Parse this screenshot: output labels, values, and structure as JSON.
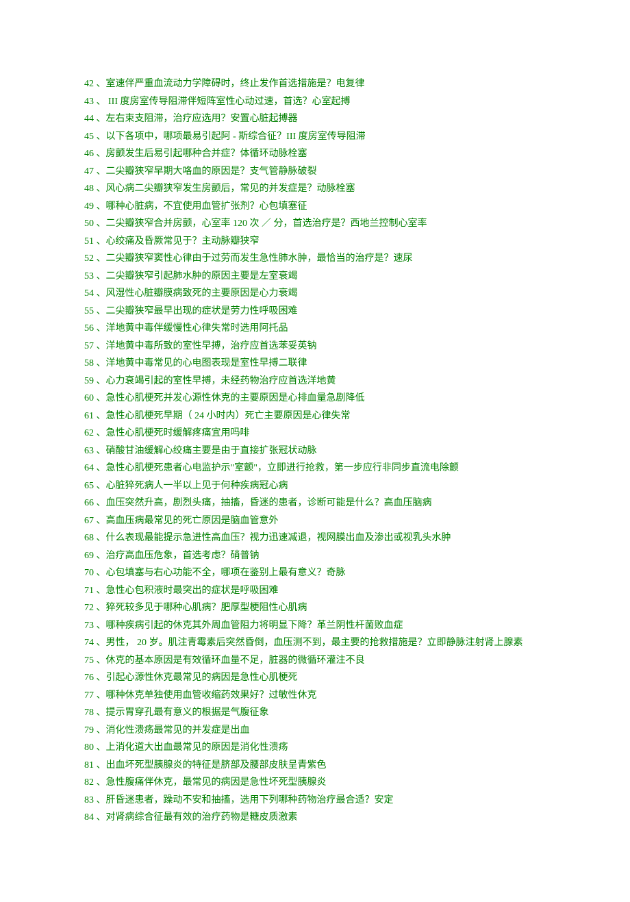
{
  "items": [
    "42 、室速伴严重血流动力学障碍时，终止发作首选措施是？电复律",
    "43 、 III 度房室传导阻滞伴短阵室性心动过速，首选？心室起搏",
    "44 、左右束支阻滞，治疗应选用？安置心脏起搏器",
    "45 、以下各项中，哪项最易引起阿 - 斯综合征？III 度房室传导阻滞",
    "46 、房颤发生后易引起哪种合并症？体循环动脉栓塞",
    "47 、二尖瓣狭窄早期大咯血的原因是？支气管静脉破裂",
    "48 、风心病二尖瓣狭窄发生房颤后，常见的并发症是？动脉栓塞",
    "49 、哪种心脏病，不宜使用血管扩张剂？心包填塞征",
    "50 、二尖瓣狭窄合并房颤，心室率 120 次 ／ 分，首选治疗是？西地兰控制心室率",
    "51 、心绞痛及昏厥常见于？主动脉瓣狭窄",
    "52 、二尖瓣狭窄窦性心律由于过劳而发生急性肺水肿，最恰当的治疗是？速尿",
    "53 、二尖瓣狭窄引起肺水肿的原因主要是左室衰竭",
    "54 、风湿性心脏瓣膜病致死的主要原因是心力衰竭",
    "55 、二尖瓣狭窄最早出现的症状是劳力性呼吸困难",
    "56 、洋地黄中毒伴缓慢性心律失常时选用阿托品",
    "57 、洋地黄中毒所致的室性早搏，治疗应首选苯妥英钠",
    "58 、洋地黄中毒常见的心电图表现是室性早搏二联律",
    "59 、心力衰竭引起的室性早搏，未经药物治疗应首选洋地黄",
    "60 、急性心肌梗死并发心源性休克的主要原因是心排血量急剧降低",
    "61 、急性心肌梗死早期（ 24 小时内）死亡主要原因是心律失常",
    "62 、急性心肌梗死时缓解疼痛宜用吗啡",
    "63 、硝酸甘油缓解心绞痛主要是由于直接扩张冠状动脉",
    "64 、急性心肌梗死患者心电监护示\"室颤\"，立即进行抢救，第一步应行非同步直流电除颤",
    "65 、心脏猝死病人一半以上见于何种疾病冠心病",
    "66 、血压突然升高，剧烈头痛，抽搐，昏迷的患者，诊断可能是什么？高血压脑病",
    "67 、高血压病最常见的死亡原因是脑血管意外",
    "68 、什么表现最能提示急进性高血压？视力迅速减退，视网膜出血及渗出或视乳头水肿",
    "69 、治疗高血压危象，首选考虑？硝普钠",
    "70 、心包填塞与右心功能不全，哪项在鉴别上最有意义？奇脉",
    "71 、急性心包积液时最突出的症状是呼吸困难",
    "72 、猝死较多见于哪种心肌病？肥厚型梗阻性心肌病",
    "73 、哪种疾病引起的休克其外周血管阻力将明显下降？革兰阴性杆菌败血症",
    "74 、男性， 20 岁。肌注青霉素后突然昏倒，血压测不到，最主要的抢救措施是？立即静脉注射肾上腺素",
    "75 、休克的基本原因是有效循环血量不足，脏器的微循环灌注不良",
    "76 、引起心源性休克最常见的病因是急性心肌梗死",
    "77 、哪种休克单独使用血管收缩药效果好？过敏性休克",
    "78 、提示胃穿孔最有意义的根据是气腹征象",
    "79 、消化性溃疡最常见的并发症是出血",
    "80 、上消化道大出血最常见的原因是消化性溃疡",
    "81 、出血坏死型胰腺炎的特征是脐部及腰部皮肤呈青紫色",
    "82 、急性腹痛伴休克，最常见的病因是急性坏死型胰腺炎",
    "83 、肝昏迷患者，躁动不安和抽搐，选用下列哪种药物治疗最合适？安定",
    "84 、对肾病综合征最有效的治疗药物是糖皮质激素"
  ]
}
